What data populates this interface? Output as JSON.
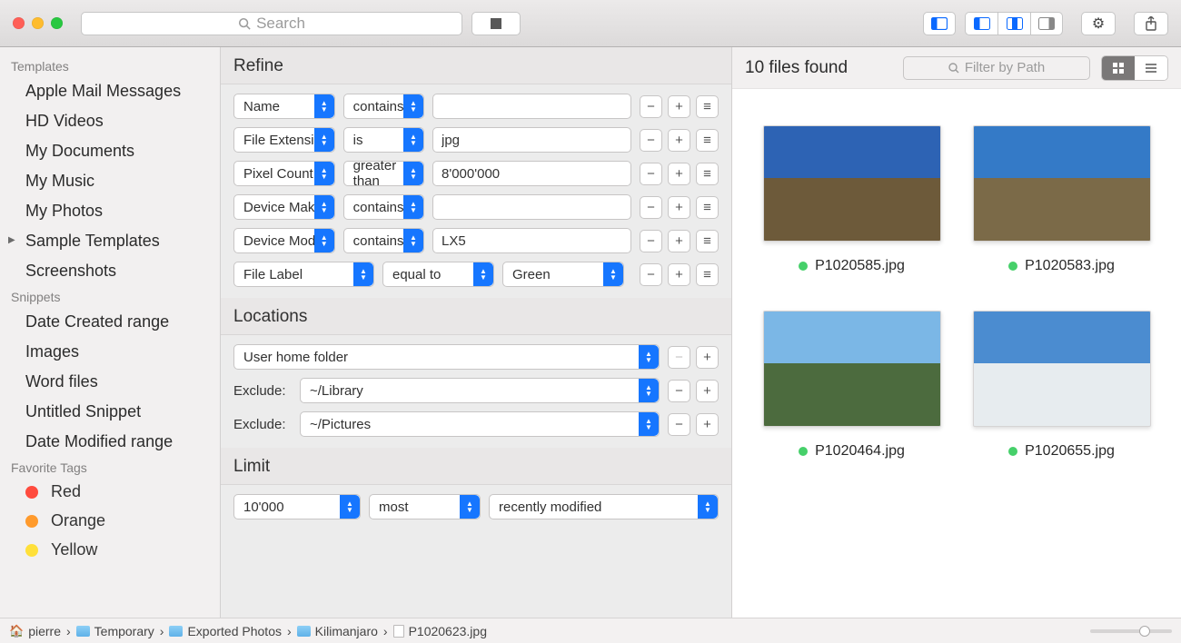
{
  "titlebar": {
    "search_placeholder": "Search"
  },
  "sidebar": {
    "groups": [
      {
        "title": "Templates",
        "items": [
          "Apple Mail Messages",
          "HD Videos",
          "My Documents",
          "My Music",
          "My Photos",
          "Sample Templates",
          "Screenshots"
        ]
      },
      {
        "title": "Snippets",
        "items": [
          "Date Created range",
          "Images",
          "Word files",
          "Untitled Snippet",
          "Date Modified range"
        ]
      }
    ],
    "tags_title": "Favorite Tags",
    "tags": [
      {
        "label": "Red",
        "color": "#ff4b3e"
      },
      {
        "label": "Orange",
        "color": "#ff9a2c"
      },
      {
        "label": "Yellow",
        "color": "#ffe03a"
      }
    ]
  },
  "refine": {
    "title": "Refine",
    "rules": [
      {
        "attr": "Name",
        "op": "contains",
        "value": ""
      },
      {
        "attr": "File Extension",
        "op": "is",
        "value": "jpg"
      },
      {
        "attr": "Pixel Count",
        "op": "greater than",
        "value": "8'000'000"
      },
      {
        "attr": "Device Make",
        "op": "contains",
        "value": ""
      },
      {
        "attr": "Device Model",
        "op": "contains",
        "value": "LX5"
      },
      {
        "attr": "File Label",
        "op": "equal to",
        "value": "Green",
        "valueIsSelect": true
      }
    ]
  },
  "locations": {
    "title": "Locations",
    "include": "User home folder",
    "exclude_label": "Exclude:",
    "excludes": [
      "~/Library",
      "~/Pictures"
    ]
  },
  "limit": {
    "title": "Limit",
    "count": "10'000",
    "mode": "most",
    "sort": "recently modified"
  },
  "results": {
    "count_text": "10 files found",
    "filter_placeholder": "Filter by Path",
    "files": [
      {
        "name": "P1020585.jpg",
        "sky": "#2d63b4",
        "ground": "#6d5a3a"
      },
      {
        "name": "P1020583.jpg",
        "sky": "#347ac7",
        "ground": "#7b6a48"
      },
      {
        "name": "P1020464.jpg",
        "sky": "#7bb7e6",
        "ground": "#4c6b3e"
      },
      {
        "name": "P1020655.jpg",
        "sky": "#4b8cd0",
        "ground": "#e7ecef"
      }
    ]
  },
  "breadcrumb": {
    "items": [
      {
        "icon": "home",
        "label": "pierre"
      },
      {
        "icon": "folder",
        "label": "Temporary"
      },
      {
        "icon": "folder",
        "label": "Exported Photos"
      },
      {
        "icon": "folder",
        "label": "Kilimanjaro"
      },
      {
        "icon": "file",
        "label": "P1020623.jpg"
      }
    ]
  }
}
